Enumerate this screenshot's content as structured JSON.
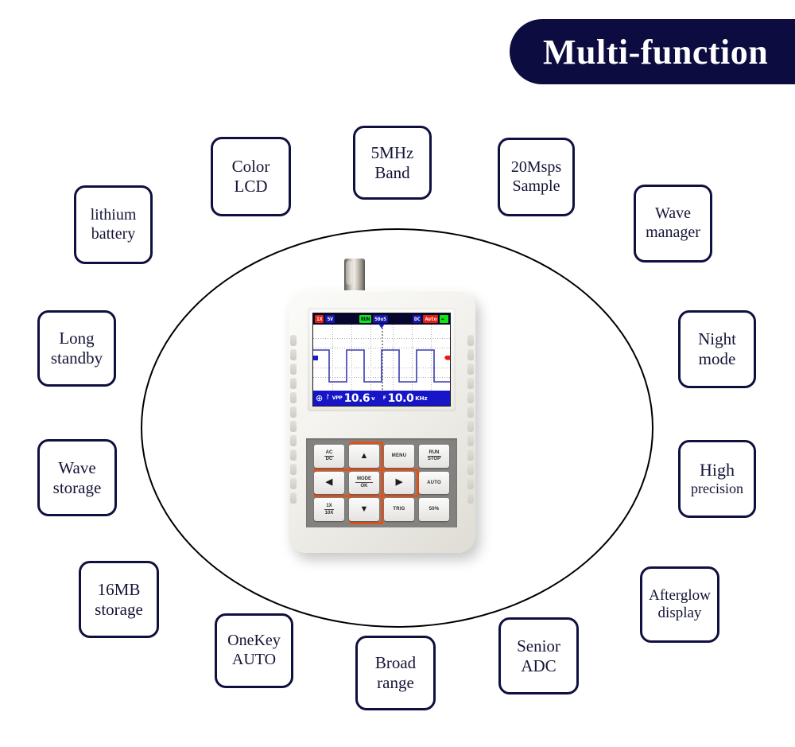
{
  "header": {
    "title": "Multi-function",
    "banner_color": "#0c0c40",
    "title_color": "#ffffff"
  },
  "features": [
    {
      "id": "color-lcd",
      "line1": "Color",
      "line2": "LCD"
    },
    {
      "id": "5mhz-band",
      "line1": "5MHz",
      "line2": "Band"
    },
    {
      "id": "20msps-sample",
      "line1": "20Msps",
      "line2": "Sample"
    },
    {
      "id": "wave-manager",
      "line1": "Wave",
      "line2": "manager"
    },
    {
      "id": "lithium-battery",
      "line1": "lithium",
      "line2": "battery"
    },
    {
      "id": "long-standby",
      "line1": "Long",
      "line2": "standby"
    },
    {
      "id": "wave-storage",
      "line1": "Wave",
      "line2": "storage"
    },
    {
      "id": "16mb-storage",
      "line1": "16MB",
      "line2": "storage"
    },
    {
      "id": "night-mode",
      "line1": "Night",
      "line2": "mode"
    },
    {
      "id": "high-precision",
      "line1": "High",
      "line2": "precision"
    },
    {
      "id": "afterglow-display",
      "line1": "Afterglow",
      "line2": "display"
    },
    {
      "id": "onekey-auto",
      "line1": "OneKey",
      "line2": "AUTO"
    },
    {
      "id": "broad-range",
      "line1": "Broad",
      "line2": "range"
    },
    {
      "id": "senior-adc",
      "line1": "Senior",
      "line2": "ADC"
    }
  ],
  "device": {
    "connector": "bnc-connector",
    "lcd": {
      "statusbar": {
        "probe": "1X",
        "volts_div": "5V",
        "run_state": "RUN",
        "time_div": "50uS",
        "coupling": "DC",
        "trigger_mode": "Auto",
        "battery": "battery-icon"
      },
      "bottombar": {
        "position_icon": "crosshair-icon",
        "wave_icon": "square-wave-icon",
        "vpp_label": "VPP",
        "vpp_value": "10.6",
        "vpp_unit": "v",
        "freq_label": "F",
        "freq_value": "10.0",
        "freq_unit": "KHz"
      },
      "waveform": {
        "type": "square",
        "cycles": 4,
        "trace_color": "#3b3bb0"
      }
    },
    "keypad": [
      {
        "id": "ac-dc",
        "top": "AC",
        "bottom": "DC",
        "single": null,
        "icon": null
      },
      {
        "id": "up",
        "top": null,
        "bottom": null,
        "single": null,
        "icon": "arrow-up-icon"
      },
      {
        "id": "menu",
        "top": null,
        "bottom": null,
        "single": "MENU",
        "icon": null
      },
      {
        "id": "run-stop",
        "top": "RUN",
        "bottom": "STOP",
        "single": null,
        "icon": null
      },
      {
        "id": "left",
        "top": null,
        "bottom": null,
        "single": null,
        "icon": "arrow-left-icon"
      },
      {
        "id": "mode-ok",
        "top": "MODE",
        "bottom": "OK",
        "single": null,
        "icon": null
      },
      {
        "id": "right",
        "top": null,
        "bottom": null,
        "single": null,
        "icon": "arrow-right-icon"
      },
      {
        "id": "auto",
        "top": null,
        "bottom": null,
        "single": "AUTO",
        "icon": null
      },
      {
        "id": "1x-10x",
        "top": "1X",
        "bottom": "10X",
        "single": null,
        "icon": null
      },
      {
        "id": "down",
        "top": null,
        "bottom": null,
        "single": null,
        "icon": "arrow-down-icon"
      },
      {
        "id": "trig",
        "top": null,
        "bottom": null,
        "single": "TRIG",
        "icon": null
      },
      {
        "id": "fifty-pct",
        "top": null,
        "bottom": null,
        "single": "50%",
        "icon": null
      }
    ],
    "highlight_color": "#e0511b"
  }
}
